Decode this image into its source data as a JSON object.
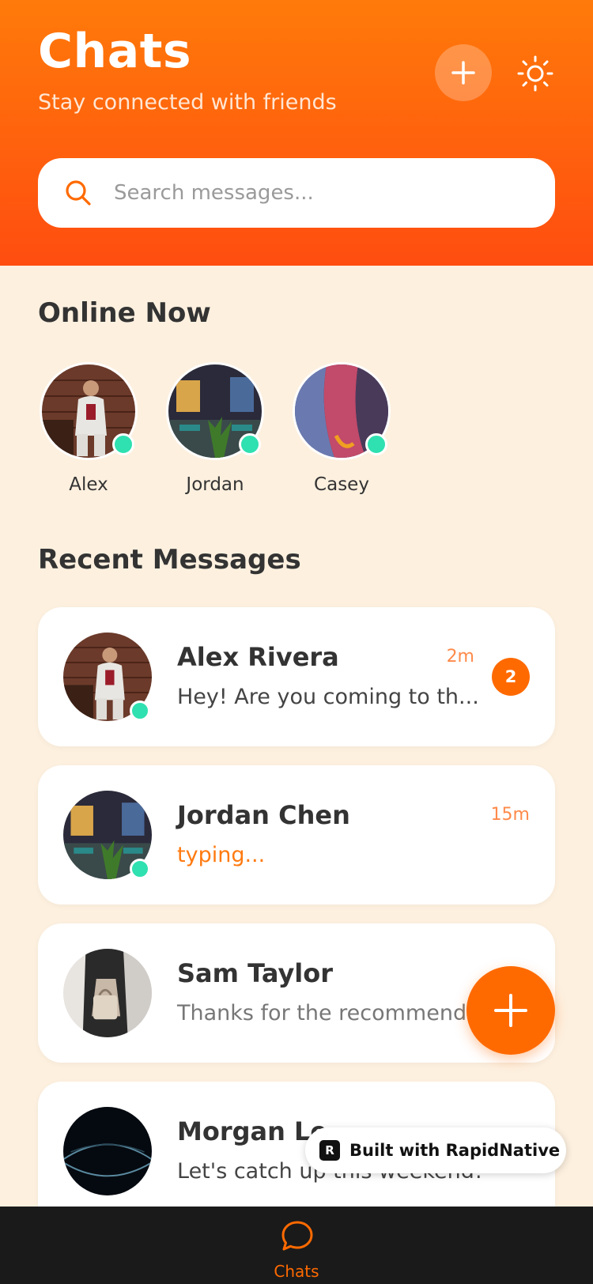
{
  "header": {
    "title": "Chats",
    "subtitle": "Stay connected with friends",
    "add_icon": "plus-icon",
    "theme_icon": "sun-icon"
  },
  "search": {
    "placeholder": "Search messages...",
    "value": "",
    "icon": "search-icon"
  },
  "online": {
    "title": "Online Now",
    "users": [
      {
        "name": "Alex"
      },
      {
        "name": "Jordan"
      },
      {
        "name": "Casey"
      }
    ]
  },
  "recent": {
    "title": "Recent Messages",
    "chats": [
      {
        "name": "Alex Rivera",
        "preview": "Hey! Are you coming to th...",
        "time": "2m",
        "unread": "2",
        "online": true
      },
      {
        "name": "Jordan Chen",
        "preview": "typing...",
        "time": "15m",
        "online": true
      },
      {
        "name": "Sam Taylor",
        "preview": "Thanks for the recommenda",
        "time": "",
        "online": false
      },
      {
        "name": "Morgan Le",
        "preview": "Let's catch up this weekend!",
        "time": "",
        "online": false
      }
    ]
  },
  "fab": {
    "icon": "plus-icon"
  },
  "badge": {
    "label": "Built with RapidNative"
  },
  "tabbar": {
    "chats_label": "Chats",
    "chats_icon": "chat-bubble-icon"
  },
  "colors": {
    "accent": "#ff6a00",
    "header_top": "#ff7a0a",
    "header_bottom": "#ff4d10",
    "background": "#fdf0df",
    "online": "#2fe0b0"
  }
}
